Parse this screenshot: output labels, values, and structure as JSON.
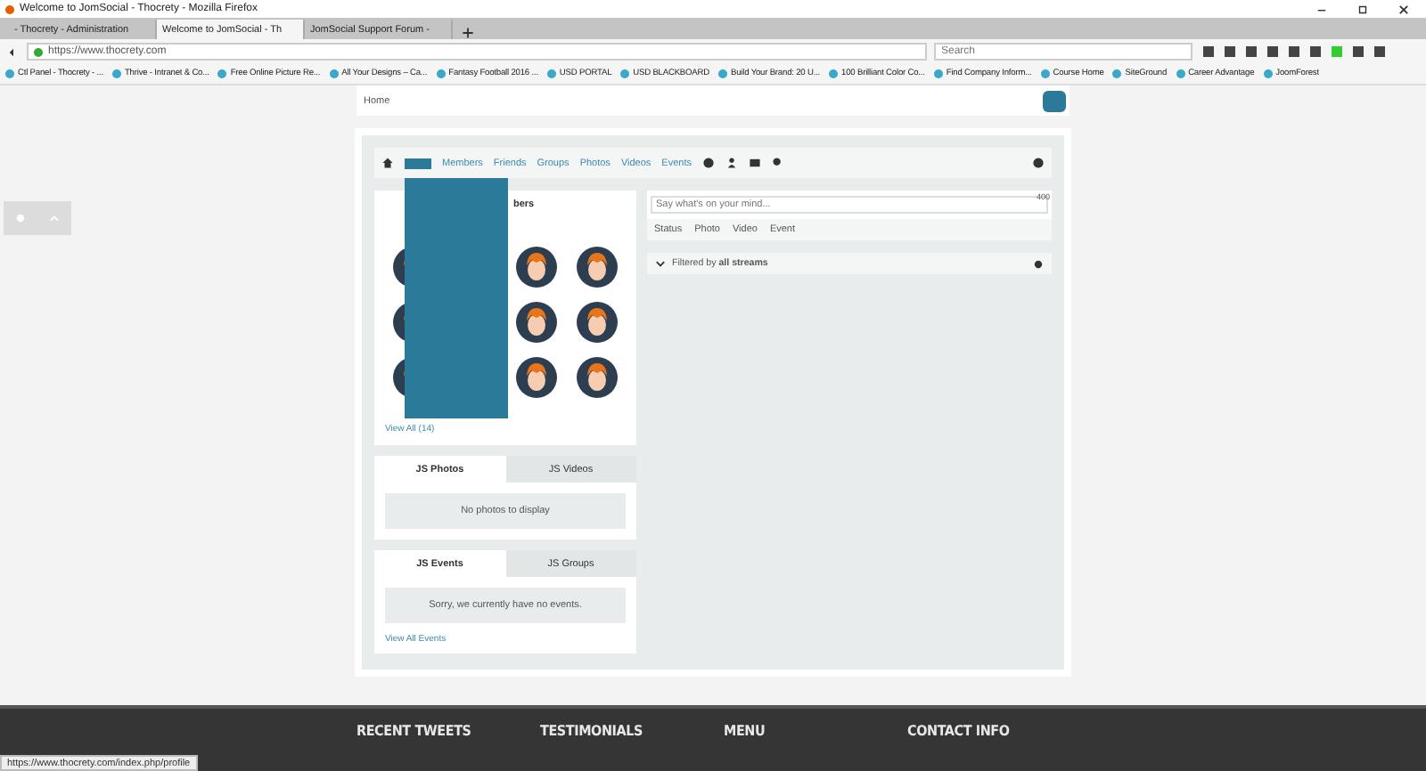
{
  "window": {
    "title": "Welcome to JomSocial - Thocrety - Mozilla Firefox"
  },
  "tabs": [
    {
      "label": "- Thocrety - Administration",
      "selected": false
    },
    {
      "label": "Welcome to JomSocial - Th",
      "selected": true
    },
    {
      "label": "JomSocial Support Forum -",
      "selected": false
    }
  ],
  "address_bar": {
    "url": "https://www.thocrety.com"
  },
  "search": {
    "placeholder": "Search"
  },
  "bookmarks": [
    "Ctl Panel - Thocrety - ...",
    "Thrive - Intranet & Co...",
    "Free Online Picture Re...",
    "All Your Designs – Ca...",
    "Fantasy Football 2016 ...",
    "USD PORTAL",
    "USD BLACKBOARD",
    "Build Your Brand: 20 U...",
    "100 Brilliant Color Co...",
    "Find Company Inform...",
    "Course Home",
    "SiteGround",
    "Career Advantage",
    "JoomForest"
  ],
  "breadcrumb": {
    "text": "Home"
  },
  "nav": {
    "items": [
      "Members",
      "Friends",
      "Groups",
      "Photos",
      "Videos",
      "Events"
    ]
  },
  "members_card": {
    "title": "bers",
    "link": "View All (14)"
  },
  "composer": {
    "placeholder": "Say what's on your mind...",
    "counter": "400",
    "actions": [
      "Status",
      "Photo",
      "Video",
      "Event"
    ]
  },
  "filter": {
    "text": "Filtered by **all streams**"
  },
  "media_card": {
    "tabs": [
      {
        "label": "JS Photos",
        "selected": true
      },
      {
        "label": "JS Videos",
        "selected": false
      }
    ],
    "message": "No photos to display"
  },
  "events_card": {
    "tabs": [
      {
        "label": "JS Events",
        "selected": true
      },
      {
        "label": "JS Groups",
        "selected": false
      }
    ],
    "message": "Sorry, we currently have no events.",
    "link": "View All Events"
  },
  "footer": {
    "headings": [
      "RECENT TWEETS",
      "TESTIMONIALS",
      "MENU",
      "CONTACT INFO"
    ]
  },
  "status_bar": {
    "url": "https://www.thocrety.com/index.php/profile"
  }
}
